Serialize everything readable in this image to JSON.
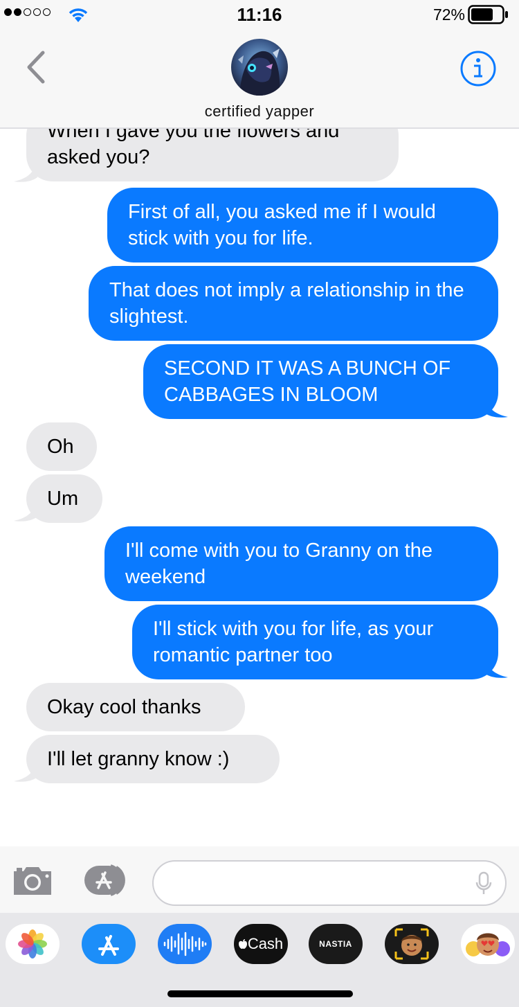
{
  "status_bar": {
    "time": "11:16",
    "battery_percent": "72%",
    "signal_bars_filled": 2,
    "signal_bars_total": 5
  },
  "header": {
    "contact_name": "certified yapper"
  },
  "messages": [
    {
      "direction": "in",
      "text": "When I gave you the flowers and asked you?"
    },
    {
      "direction": "out",
      "text": "First of all, you asked me if I would stick with you for life."
    },
    {
      "direction": "out",
      "text": "That does not imply a relationship in the slightest."
    },
    {
      "direction": "out",
      "text": "SECOND IT WAS A BUNCH OF CABBAGES IN BLOOM"
    },
    {
      "direction": "in",
      "text": "Oh"
    },
    {
      "direction": "in",
      "text": "Um"
    },
    {
      "direction": "out",
      "text": "I'll come with you to Granny on the weekend"
    },
    {
      "direction": "out",
      "text": "I'll stick with you for life, as your romantic partner too"
    },
    {
      "direction": "in",
      "text": "Okay cool thanks"
    },
    {
      "direction": "in",
      "text": "I'll let granny know :)"
    }
  ],
  "input": {
    "value": "",
    "placeholder": ""
  },
  "app_drawer": {
    "apps": [
      {
        "name": "photos-icon",
        "label": ""
      },
      {
        "name": "app-store-icon",
        "label": ""
      },
      {
        "name": "audio-waveform-icon",
        "label": ""
      },
      {
        "name": "apple-cash-icon",
        "label": "Cash"
      },
      {
        "name": "nastia-icon",
        "label": "NASTIA"
      },
      {
        "name": "memoji-icon",
        "label": ""
      },
      {
        "name": "animoji-stickers-icon",
        "label": ""
      }
    ]
  },
  "colors": {
    "outgoing_bubble": "#0a7aff",
    "incoming_bubble": "#e9e9eb",
    "accent": "#0a7aff"
  }
}
